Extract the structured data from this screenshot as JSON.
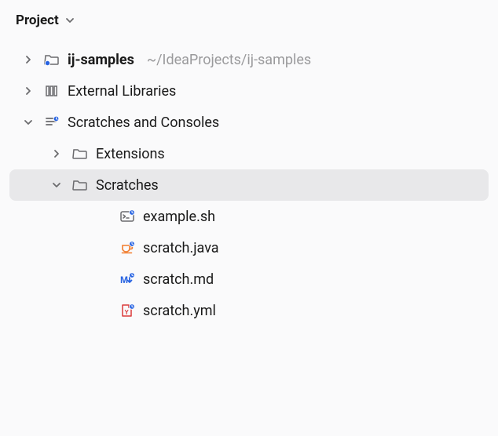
{
  "header": {
    "title": "Project"
  },
  "tree": {
    "nodes": [
      {
        "id": "ij-samples",
        "label": "ij-samples",
        "hint": "~/IdeaProjects/ij-samples",
        "icon": "project-folder",
        "twisty": "collapsed",
        "indent": 0,
        "bold": true,
        "selected": false
      },
      {
        "id": "ext-lib",
        "label": "External Libraries",
        "hint": "",
        "icon": "libraries",
        "twisty": "collapsed",
        "indent": 0,
        "bold": false,
        "selected": false
      },
      {
        "id": "scratches-consoles",
        "label": "Scratches and Consoles",
        "hint": "",
        "icon": "scratches-root",
        "twisty": "expanded",
        "indent": 0,
        "bold": false,
        "selected": false
      },
      {
        "id": "extensions",
        "label": "Extensions",
        "hint": "",
        "icon": "folder",
        "twisty": "collapsed",
        "indent": 1,
        "bold": false,
        "selected": false
      },
      {
        "id": "scratches",
        "label": "Scratches",
        "hint": "",
        "icon": "folder",
        "twisty": "expanded",
        "indent": 1,
        "bold": false,
        "selected": true
      },
      {
        "id": "example-sh",
        "label": "example.sh",
        "hint": "",
        "icon": "shell-file",
        "twisty": "none",
        "indent": 3,
        "bold": false,
        "selected": false
      },
      {
        "id": "scratch-java",
        "label": "scratch.java",
        "hint": "",
        "icon": "java-file",
        "twisty": "none",
        "indent": 3,
        "bold": false,
        "selected": false
      },
      {
        "id": "scratch-md",
        "label": "scratch.md",
        "hint": "",
        "icon": "md-file",
        "twisty": "none",
        "indent": 3,
        "bold": false,
        "selected": false
      },
      {
        "id": "scratch-yml",
        "label": "scratch.yml",
        "hint": "",
        "icon": "yml-file",
        "twisty": "none",
        "indent": 3,
        "bold": false,
        "selected": false
      }
    ]
  },
  "colors": {
    "text": "#1a1a1a",
    "hint": "#9a9a9c",
    "selectedBg": "#e8e8ea",
    "blueDot": "#2763e2",
    "javaOrange": "#f27c2c",
    "mdBlue": "#2763e2",
    "ymlRed": "#db3b3b"
  }
}
